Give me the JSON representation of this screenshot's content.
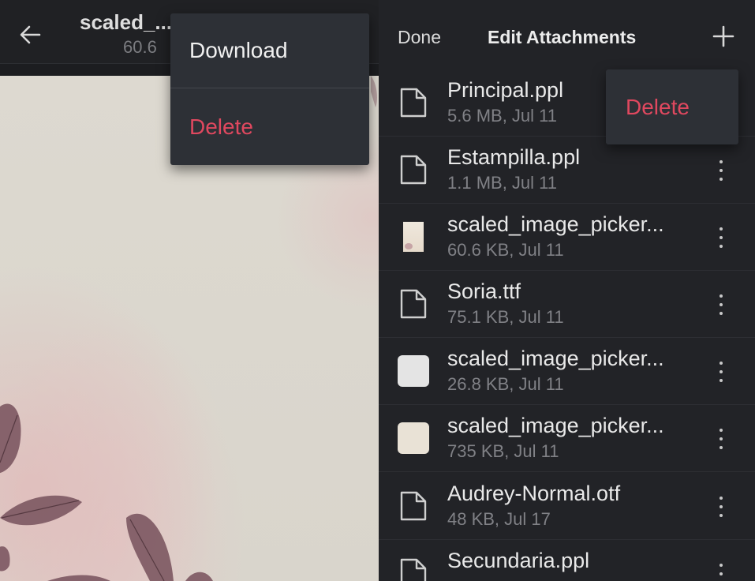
{
  "viewer": {
    "title": "scaled_...",
    "subtitle": "60.6",
    "menu": {
      "download_label": "Download",
      "delete_label": "Delete"
    }
  },
  "panel": {
    "done_label": "Done",
    "title": "Edit Attachments",
    "add_icon": "plus-icon",
    "row_menu": {
      "delete_label": "Delete"
    },
    "items": [
      {
        "name": "Principal.ppl",
        "meta": "5.6 MB, Jul 11",
        "icon": "file-icon"
      },
      {
        "name": "Estampilla.ppl",
        "meta": "1.1 MB, Jul 11",
        "icon": "file-icon"
      },
      {
        "name": "scaled_image_picker...",
        "meta": "60.6 KB, Jul 11",
        "icon": "image-thumbnail"
      },
      {
        "name": "Soria.ttf",
        "meta": "75.1 KB, Jul 11",
        "icon": "file-icon"
      },
      {
        "name": "scaled_image_picker...",
        "meta": "26.8 KB, Jul 11",
        "icon": "image-thumbnail",
        "color": "#e4e4e4"
      },
      {
        "name": "scaled_image_picker...",
        "meta": "735 KB, Jul 11",
        "icon": "image-thumbnail",
        "color": "#e9e2d6"
      },
      {
        "name": "Audrey-Normal.otf",
        "meta": "48 KB, Jul 17",
        "icon": "file-icon"
      },
      {
        "name": "Secundaria.ppl",
        "meta": "",
        "icon": "file-icon"
      }
    ]
  },
  "colors": {
    "accent_delete": "#e0485f",
    "menu_bg": "#2d3036",
    "panel_bg": "#222327"
  }
}
